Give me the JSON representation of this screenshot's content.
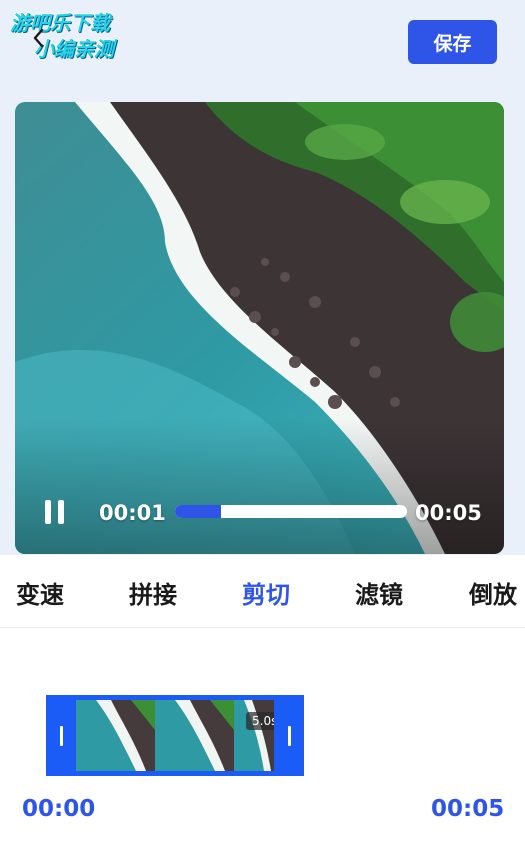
{
  "watermark": {
    "line1": "游吧乐下载",
    "line2": "小编亲测"
  },
  "header": {
    "save_label": "保存"
  },
  "player": {
    "current_time": "00:01",
    "total_time": "00:05",
    "progress": 0.2
  },
  "tabs": [
    {
      "label": "变速",
      "active": false
    },
    {
      "label": "拼接",
      "active": false
    },
    {
      "label": "剪切",
      "active": true
    },
    {
      "label": "滤镜",
      "active": false
    },
    {
      "label": "倒放",
      "active": false
    }
  ],
  "timeline": {
    "duration_badge": "5.0s",
    "start_time": "00:00",
    "end_time": "00:05"
  },
  "colors": {
    "accent": "#2f55e8",
    "timeline_frame": "#1b5cf7",
    "background": "#e9f0f9"
  }
}
